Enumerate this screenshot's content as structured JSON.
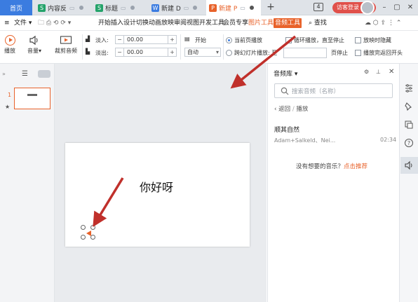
{
  "tabs": [
    {
      "label": "首页"
    },
    {
      "label": "内容反",
      "icon": "S"
    },
    {
      "label": "标题",
      "icon": "S"
    },
    {
      "label": "新建 D",
      "icon": "W"
    },
    {
      "label": "新建 P",
      "icon": "P"
    }
  ],
  "tabbar": {
    "plus": "+",
    "count": "4",
    "guest": "访客登录"
  },
  "menu": {
    "file": "文件",
    "items": [
      "开始",
      "插入",
      "设计",
      "切换",
      "动画",
      "放映",
      "审阅",
      "视图",
      "开发工具",
      "会员专享"
    ],
    "picture_tools": "图片工具",
    "audio_tools": "音频工具",
    "search": "查找"
  },
  "toolbar": {
    "play": "播放",
    "volume": "音量",
    "trim": "裁剪音频",
    "fade_in_label": "淡入:",
    "fade_in_value": "00.00",
    "fade_out_label": "淡出:",
    "fade_out_value": "00.00",
    "start_label": "开始",
    "start_value": "自动",
    "current_page": "当前页播放",
    "cross_slides": "跨幻灯片播放: 至",
    "page_stop": "页停止",
    "loop": "循环播放，直至停止",
    "hide_when_playing": "放映时隐藏",
    "rewind": "播放完返回开头"
  },
  "slide_panel": {
    "slide_number": "1"
  },
  "slide": {
    "text": "你好呀"
  },
  "library": {
    "title": "音频库",
    "search_placeholder": "搜索音频（名称）",
    "back": "返回",
    "crumb_current": "播放",
    "track_title": "顺其自然",
    "track_artist": "Adam+Salkeld、Nei...",
    "track_duration": "02:34",
    "empty_text": "没有想要的音乐？",
    "empty_link": "点击推荐"
  },
  "colors": {
    "accent": "#e8622a",
    "home_tab": "#3b7ce0",
    "arrow": "#c0302b"
  }
}
